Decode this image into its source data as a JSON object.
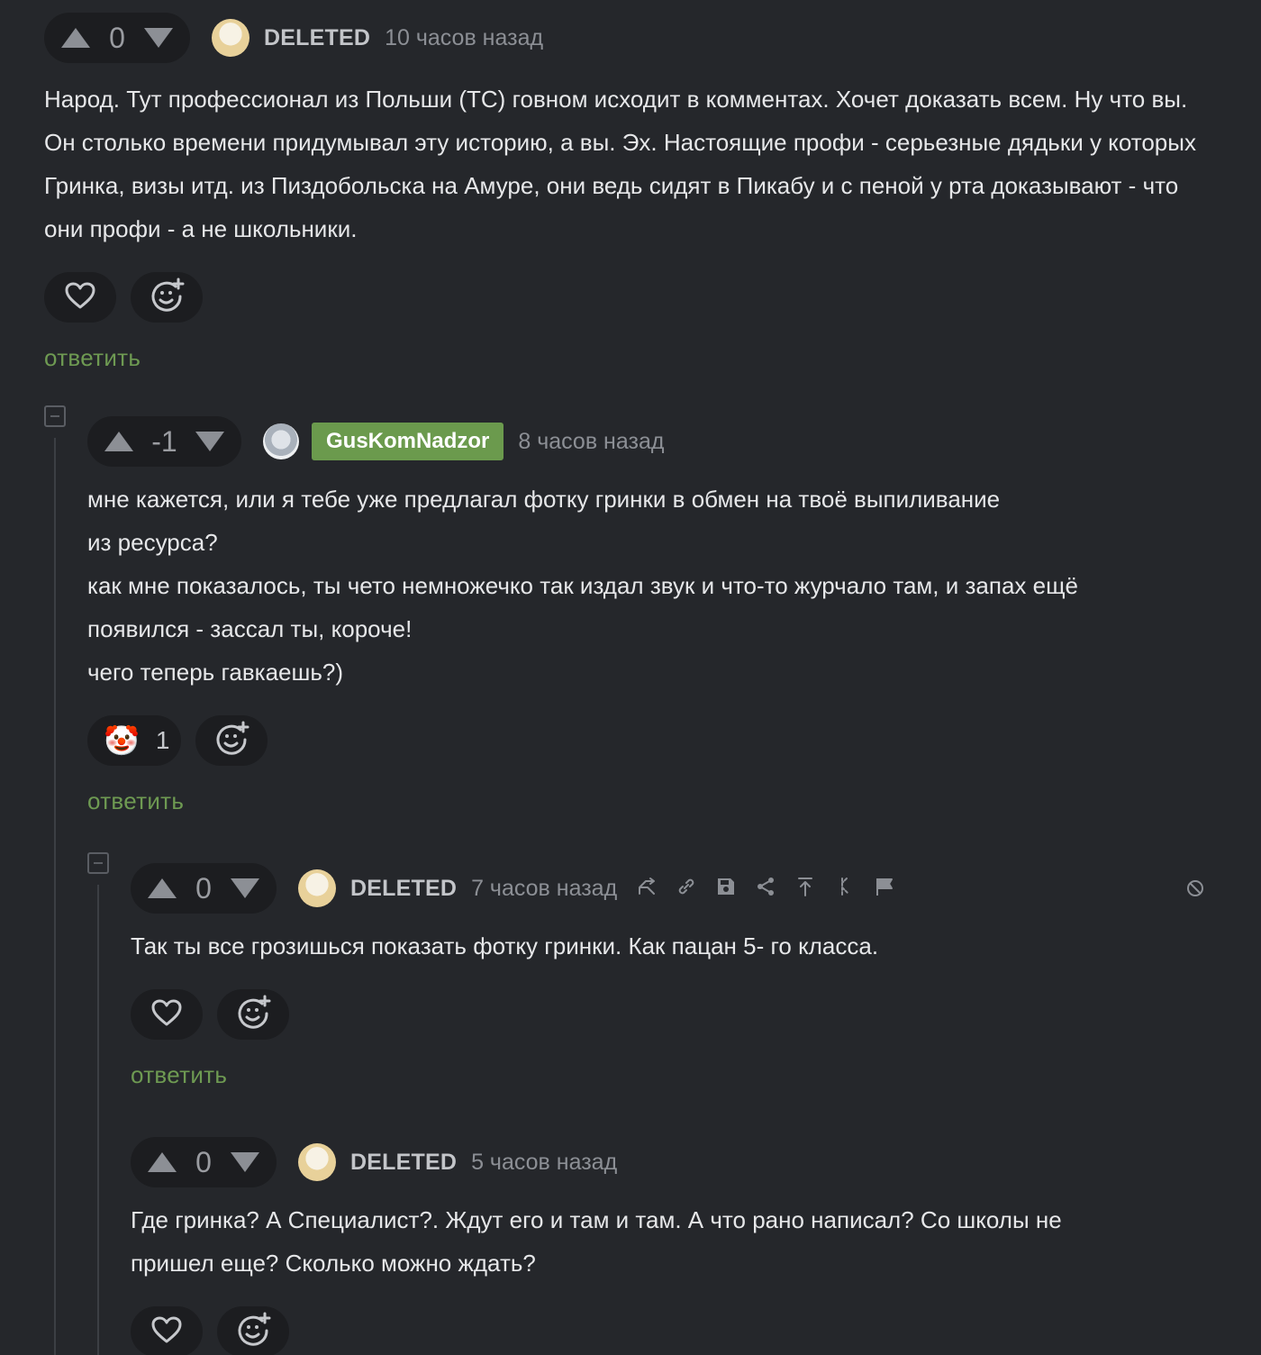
{
  "comments": [
    {
      "score": "0",
      "author": "DELETED",
      "time": "10 часов назад",
      "text": "Народ. Тут профессионал из Польши (ТС) говном исходит в комментах. Хочет доказать всем. Ну что вы. Он столько времени придумывал эту историю, а вы. Эх. Настоящие профи - серьезные дядьки у которых Гринка, визы итд. из Пиздобольска на Амуре, они ведь сидят в Пикабу и с пеной у рта доказывают - что они профи - а не школьники.",
      "reply_label": "ответить"
    },
    {
      "score": "-1",
      "author": "GusKomNadzor",
      "time": "8 часов назад",
      "text_lines": [
        "мне кажется, или я тебе уже предлагал фотку гринки в обмен на твоё выпиливание",
        "из ресурса?",
        "как мне показалось, ты чето немножечко так издал звук и что-то журчало там, и запах ещё",
        "появился - зассал ты, короче!",
        "чего теперь гавкаешь?)"
      ],
      "reaction_emoji": "🤡",
      "reaction_count": "1",
      "reply_label": "ответить"
    },
    {
      "score": "0",
      "author": "DELETED",
      "time": "7 часов назад",
      "text": "Так ты все грозишься показать фотку гринки. Как пацан 5- го класса.",
      "reply_label": "ответить"
    },
    {
      "score": "0",
      "author": "DELETED",
      "time": "5 часов назад",
      "text": "Где гринка? А Специалист?. Ждут его и там и там. А что рано написал? Со школы не пришел еще? Сколько можно ждать?"
    }
  ],
  "colors": {
    "background": "#25272b",
    "pill": "#1c1d20",
    "reply_green": "#6e9a52",
    "badge_green": "#6b9a4d"
  },
  "icons": {
    "upvote": "triangle-up-icon",
    "downvote": "triangle-down-icon",
    "like": "heart-icon",
    "add_reaction": "smiley-plus-icon",
    "tools": [
      "branch-icon",
      "link-icon",
      "save-icon",
      "share-icon",
      "go-top-icon",
      "go-parent-icon",
      "flag-icon",
      "block-icon"
    ]
  }
}
